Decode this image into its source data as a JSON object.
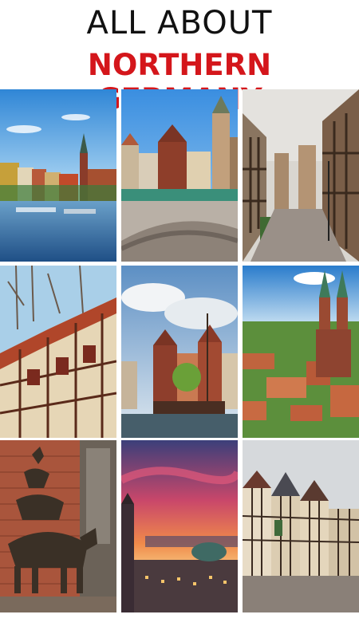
{
  "title": {
    "line1": "ALL ABOUT",
    "line2": "NORTHERN GERMANY"
  },
  "colors": {
    "accent": "#d4161b",
    "heading": "#111111"
  },
  "photos": [
    {
      "subject": "lubeck-waterfront-photo"
    },
    {
      "subject": "bremen-market-square-photo"
    },
    {
      "subject": "half-timbered-lane-photo"
    },
    {
      "subject": "half-timbered-facade-photo"
    },
    {
      "subject": "harbor-ship-photo"
    },
    {
      "subject": "lubeck-aerial-cathedral-photo"
    },
    {
      "subject": "bremen-town-musicians-statue-photo"
    },
    {
      "subject": "hamburg-sunset-skyline-photo"
    },
    {
      "subject": "half-timbered-street-photo"
    }
  ]
}
